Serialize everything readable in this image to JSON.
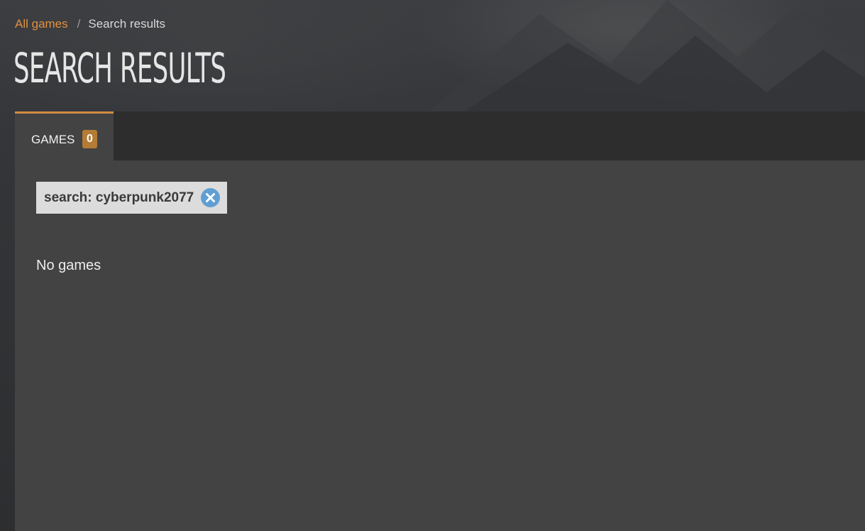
{
  "breadcrumb": {
    "items": [
      {
        "label": "All games",
        "link": true
      },
      {
        "label": "Search results",
        "link": false
      }
    ],
    "separator": "/"
  },
  "page": {
    "title": "SEARCH RESULTS"
  },
  "tabs": [
    {
      "label": "GAMES",
      "count": "0",
      "active": true
    }
  ],
  "filter": {
    "label": "search: cyberpunk2077",
    "remove_icon": "close-circle-icon"
  },
  "results": {
    "empty_message": "No games"
  },
  "colors": {
    "accent": "#e2903e",
    "tab_underline": "#d38c44",
    "badge": "#b47c35",
    "panel": "#434343",
    "tab_bar": "#2d2d2d",
    "chip": "#dcdcdc",
    "chip_remove": "#5f9fd3"
  }
}
